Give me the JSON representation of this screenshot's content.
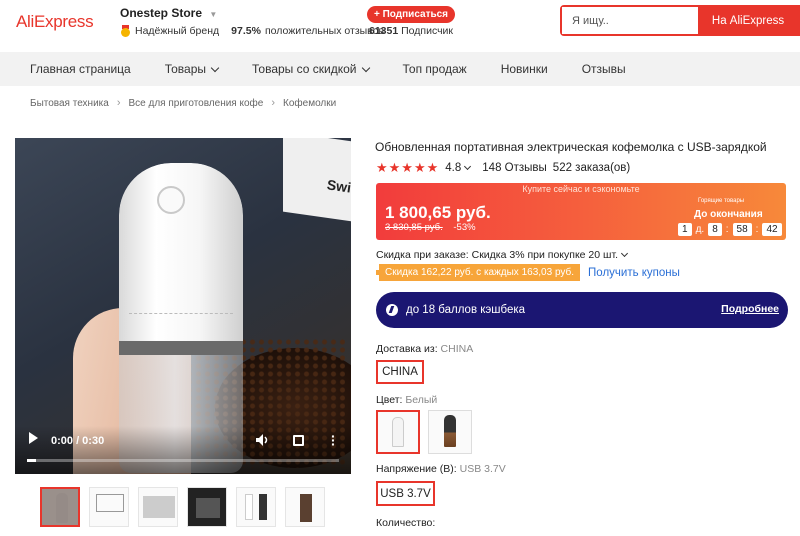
{
  "header": {
    "logo": "AliExpress",
    "store_name": "Onestep Store",
    "trusted_brand": "Надёжный бренд",
    "positive_percent": "97.5%",
    "positive_text": "положительных отзывов",
    "subscribe_label": "+ Подписаться",
    "subscribers_count": "61351",
    "subscribers_label": "Подписчик",
    "search_placeholder": "Я ищу..",
    "search_button": "На AliExpress"
  },
  "nav": {
    "items": [
      {
        "label": "Главная страница",
        "dropdown": false
      },
      {
        "label": "Товары",
        "dropdown": true
      },
      {
        "label": "Товары со скидкой",
        "dropdown": true
      },
      {
        "label": "Топ продаж",
        "dropdown": false
      },
      {
        "label": "Новинки",
        "dropdown": false
      },
      {
        "label": "Отзывы",
        "dropdown": false
      }
    ]
  },
  "breadcrumb": [
    "Бытовая техника",
    "Все для приготовления кофе",
    "Кофемолки"
  ],
  "video": {
    "time": "0:00 / 0:30",
    "box_text": "Swi",
    "progress": 0.03
  },
  "product": {
    "title": "Обновленная портативная электрическая кофемолка с USB-зарядкой",
    "stars": "★★★★★",
    "rating": "4.8",
    "reviews": "148 Отзывы",
    "orders": "522 заказа(ов)"
  },
  "deal": {
    "banner": "Купите сейчас и сэкономьте",
    "price": "1 800,65 руб.",
    "old_price": "3 830,85 руб.",
    "discount": "-53%",
    "hot_label": "Горящие товары",
    "ends_label": "До окончания",
    "timer_days": "1",
    "days_unit": "д.",
    "timer_hours": "8",
    "timer_minutes": "58",
    "timer_seconds": "42"
  },
  "promo": {
    "order_discount": "Скидка при заказе: Скидка 3% при покупке 20 шт.",
    "coupon_tag": "Скидка 162,22 руб. с каждых 163,03 руб.",
    "coupon_link": "Получить купоны"
  },
  "cashback": {
    "text": "до 18 баллов кэшбека",
    "more": "Подробнее"
  },
  "options": {
    "ship_from_label": "Доставка из:",
    "ship_from_value": "CHINA",
    "ship_from_selected": "CHINA",
    "color_label": "Цвет:",
    "color_value": "Белый",
    "voltage_label": "Напряжение (В):",
    "voltage_value": "USB 3.7V",
    "voltage_selected": "USB 3.7V",
    "quantity_label": "Количество:"
  },
  "colors": {
    "accent": "#e8352b",
    "cashback_bg": "#1b1672",
    "link": "#2a6fd6"
  }
}
